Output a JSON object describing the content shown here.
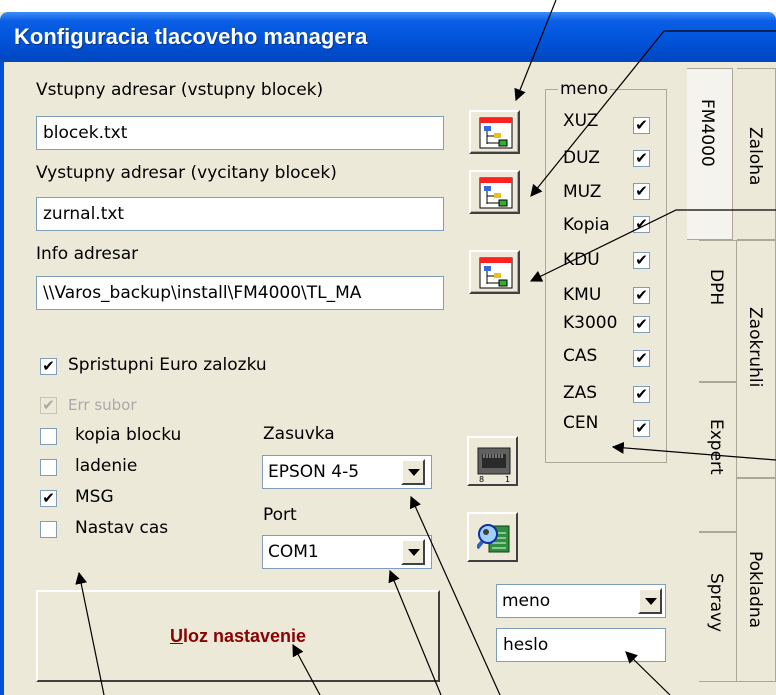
{
  "window": {
    "title": "Konfiguracia tlacoveho managera"
  },
  "fields": {
    "input_dir": {
      "label": "Vstupny adresar (vstupny blocek)",
      "value": "blocek.txt"
    },
    "output_dir": {
      "label": "Vystupny adresar (vycitany blocek)",
      "value": "zurnal.txt"
    },
    "info_dir": {
      "label": "Info adresar",
      "value": "\\\\Varos_backup\\install\\FM4000\\TL_MA"
    }
  },
  "options": [
    {
      "label": "Spristupni Euro zalozku",
      "checked": true,
      "enabled": true
    },
    {
      "label": "Err subor",
      "checked": true,
      "enabled": false
    },
    {
      "label": "kopia blocku",
      "checked": false,
      "enabled": true
    },
    {
      "label": "ladenie",
      "checked": false,
      "enabled": true
    },
    {
      "label": "MSG",
      "checked": true,
      "enabled": true
    },
    {
      "label": "Nastav cas",
      "checked": false,
      "enabled": true
    }
  ],
  "socket": {
    "label": "Zasuvka",
    "value": "EPSON 4-5"
  },
  "port": {
    "label": "Port",
    "value": "COM1"
  },
  "reports": {
    "title": "meno",
    "items": [
      {
        "label": "XUZ",
        "checked": true
      },
      {
        "label": "DUZ",
        "checked": true
      },
      {
        "label": "MUZ",
        "checked": true
      },
      {
        "label": "Kopia",
        "checked": true
      },
      {
        "label": "KDU",
        "checked": true
      },
      {
        "label": "KMU",
        "checked": true
      },
      {
        "label": "K3000",
        "checked": true
      },
      {
        "label": "CAS",
        "checked": true
      },
      {
        "label": "ZAS",
        "checked": true
      },
      {
        "label": "CEN",
        "checked": true
      }
    ]
  },
  "login": {
    "user": "meno",
    "password": "heslo"
  },
  "save_button": {
    "accel": "U",
    "rest": "loz nastavenie"
  },
  "tabs": {
    "col1": [
      "FM4000",
      "DPH",
      "Expert",
      "Spravy"
    ],
    "col2": [
      "Zaloha",
      "Zaokruhli",
      "Pokladna"
    ]
  },
  "check_glyph": "✔"
}
